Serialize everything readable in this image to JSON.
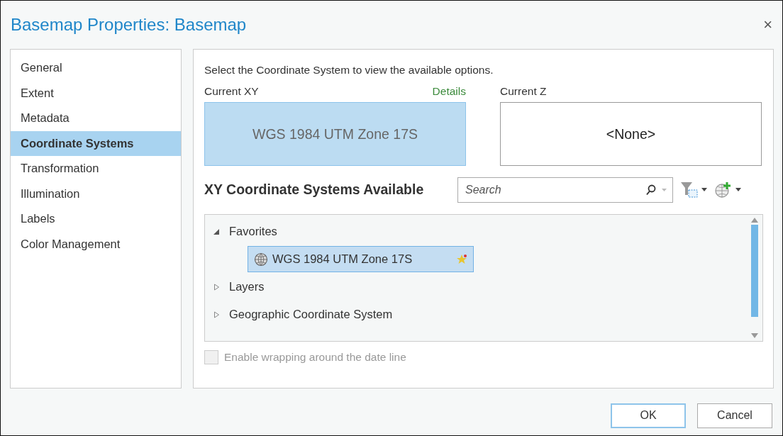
{
  "window": {
    "title": "Basemap Properties: Basemap",
    "close": "×"
  },
  "sidebar": {
    "items": [
      {
        "label": "General",
        "selected": false
      },
      {
        "label": "Extent",
        "selected": false
      },
      {
        "label": "Metadata",
        "selected": false
      },
      {
        "label": "Coordinate Systems",
        "selected": true
      },
      {
        "label": "Transformation",
        "selected": false
      },
      {
        "label": "Illumination",
        "selected": false
      },
      {
        "label": "Labels",
        "selected": false
      },
      {
        "label": "Color Management",
        "selected": false
      }
    ]
  },
  "instructions": "Select the Coordinate System to view the available options.",
  "current_xy": {
    "label": "Current XY",
    "link": "Details",
    "value": "WGS 1984 UTM Zone 17S"
  },
  "current_z": {
    "label": "Current Z",
    "value": "<None>"
  },
  "available": {
    "heading": "XY Coordinate Systems Available",
    "search": {
      "placeholder": "Search"
    }
  },
  "tree": [
    {
      "label": "Favorites",
      "expanded": true,
      "children": [
        {
          "label": "WGS 1984 UTM Zone 17S",
          "selected": true,
          "favorite": true
        }
      ]
    },
    {
      "label": "Layers",
      "expanded": false
    },
    {
      "label": "Geographic Coordinate System",
      "expanded": false
    }
  ],
  "wrap_option": {
    "label": "Enable wrapping around the date line",
    "checked": false,
    "disabled": true
  },
  "buttons": [
    {
      "label": "OK",
      "kind": "default"
    },
    {
      "label": "Cancel",
      "kind": "normal"
    }
  ]
}
